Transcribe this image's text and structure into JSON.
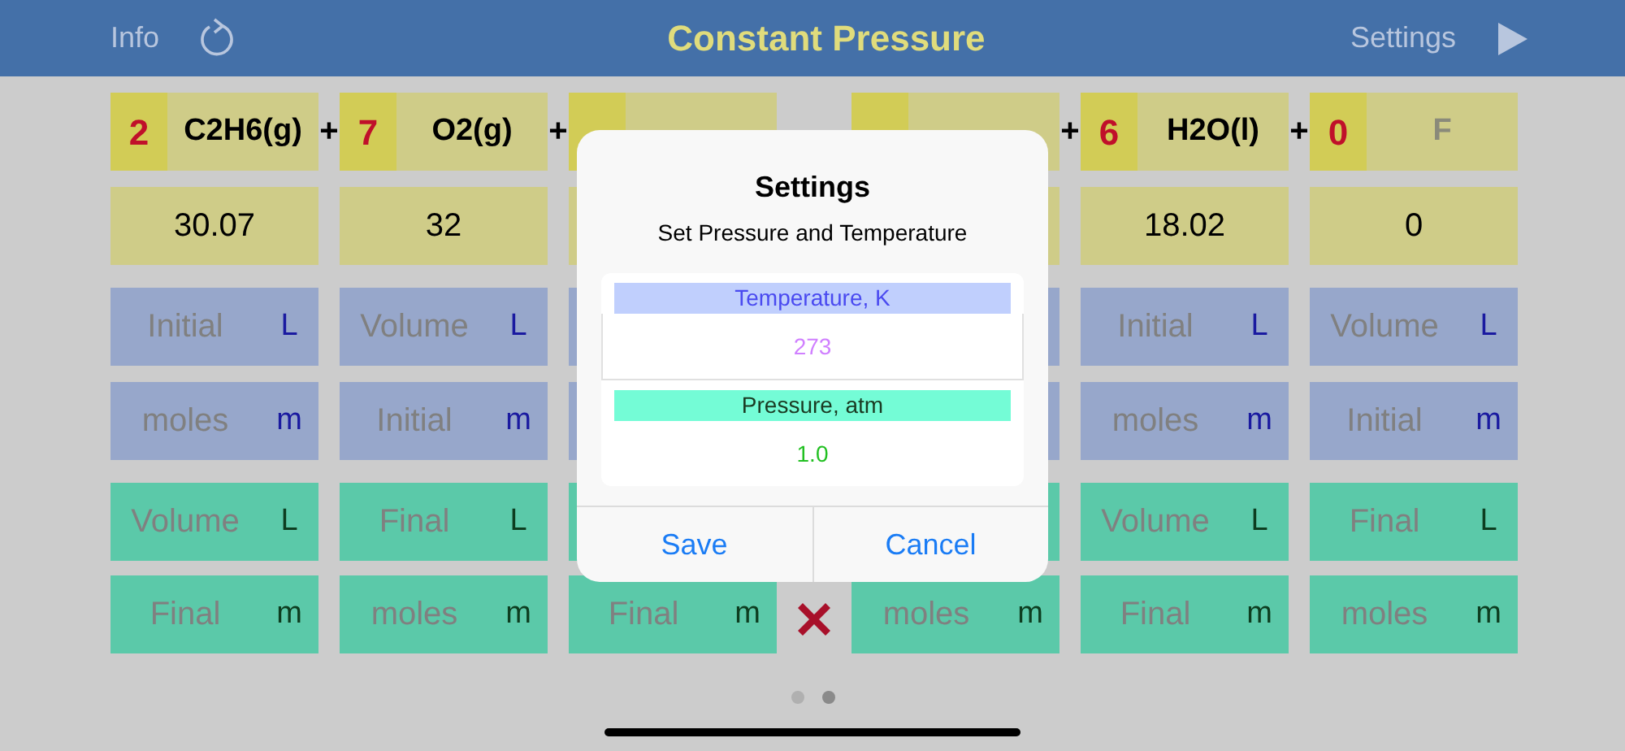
{
  "header": {
    "left_button": "Info",
    "title": "Constant Pressure",
    "right_button": "Settings"
  },
  "columns": [
    {
      "coefficient": "2",
      "formula": "C2H6(g)",
      "placeholder": false,
      "molar_mass": "30.07",
      "operator": "+",
      "cells": [
        {
          "kind": "initial",
          "label": "Initial",
          "unit": "L"
        },
        {
          "kind": "initial",
          "label": "moles",
          "unit": "m"
        },
        {
          "kind": "final",
          "label": "Volume",
          "unit": "L"
        },
        {
          "kind": "final",
          "label": "Final",
          "unit": "m"
        }
      ]
    },
    {
      "coefficient": "7",
      "formula": "O2(g)",
      "placeholder": false,
      "molar_mass": "32",
      "operator": "+",
      "cells": [
        {
          "kind": "initial",
          "label": "Volume",
          "unit": "L"
        },
        {
          "kind": "initial",
          "label": "Initial",
          "unit": "m"
        },
        {
          "kind": "final",
          "label": "Final",
          "unit": "L"
        },
        {
          "kind": "final",
          "label": "moles",
          "unit": "m"
        }
      ]
    },
    {
      "cells": [
        {
          "kind": "initial"
        },
        {
          "kind": "initial"
        },
        {
          "kind": "final"
        },
        {
          "kind": "final",
          "label": "Final",
          "unit": "m"
        }
      ]
    },
    {
      "operator": "+",
      "cells": [
        {
          "kind": "initial"
        },
        {
          "kind": "initial"
        },
        {
          "kind": "final"
        },
        {
          "kind": "final",
          "label": "moles",
          "unit": "m"
        }
      ]
    },
    {
      "coefficient": "6",
      "formula": "H2O(l)",
      "placeholder": false,
      "molar_mass": "18.02",
      "operator": "+",
      "cells": [
        {
          "kind": "initial",
          "label": "Initial",
          "unit": "L"
        },
        {
          "kind": "initial",
          "label": "moles",
          "unit": "m"
        },
        {
          "kind": "final",
          "label": "Volume",
          "unit": "L"
        },
        {
          "kind": "final",
          "label": "Final",
          "unit": "m"
        }
      ]
    },
    {
      "coefficient": "0",
      "formula": "F",
      "placeholder": true,
      "molar_mass": "0",
      "cells": [
        {
          "kind": "initial",
          "label": "Volume",
          "unit": "L"
        },
        {
          "kind": "initial",
          "label": "Initial",
          "unit": "m"
        },
        {
          "kind": "final",
          "label": "Final",
          "unit": "L"
        },
        {
          "kind": "final",
          "label": "moles",
          "unit": "m"
        }
      ]
    }
  ],
  "dialog": {
    "title": "Settings",
    "subtitle": "Set Pressure and Temperature",
    "fields": [
      {
        "kind": "temperature",
        "label": "Temperature, K",
        "value": "273"
      },
      {
        "kind": "pressure",
        "label": "Pressure, atm",
        "value": "1.0"
      }
    ],
    "buttons": [
      "Save",
      "Cancel"
    ]
  },
  "page_dots": [
    {
      "selected": false
    },
    {
      "selected": true
    }
  ]
}
